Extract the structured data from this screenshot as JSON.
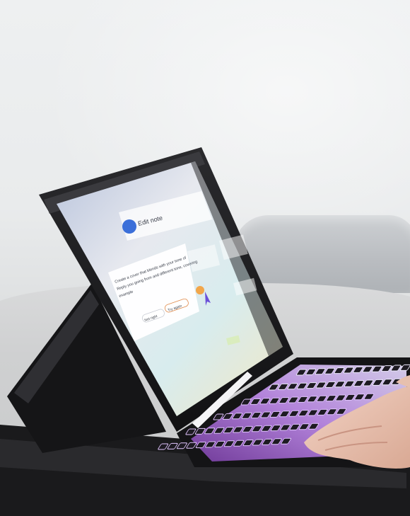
{
  "photo": {
    "subject": "tablet-with-backlit-keyboard-case"
  },
  "screen": {
    "app_name": "Edit note",
    "prompt_text_line1": "Create a cover that blends with your tone of",
    "prompt_text_line2": "Reply you going from and different tone, covering",
    "prompt_text_line3": "example",
    "button_cancel": "Not right",
    "button_generate": "Try again"
  },
  "colors": {
    "keyboard_glow": "#d9b8f5",
    "screen_tint": "#c8e3ea",
    "case": "#1c1c1e"
  }
}
